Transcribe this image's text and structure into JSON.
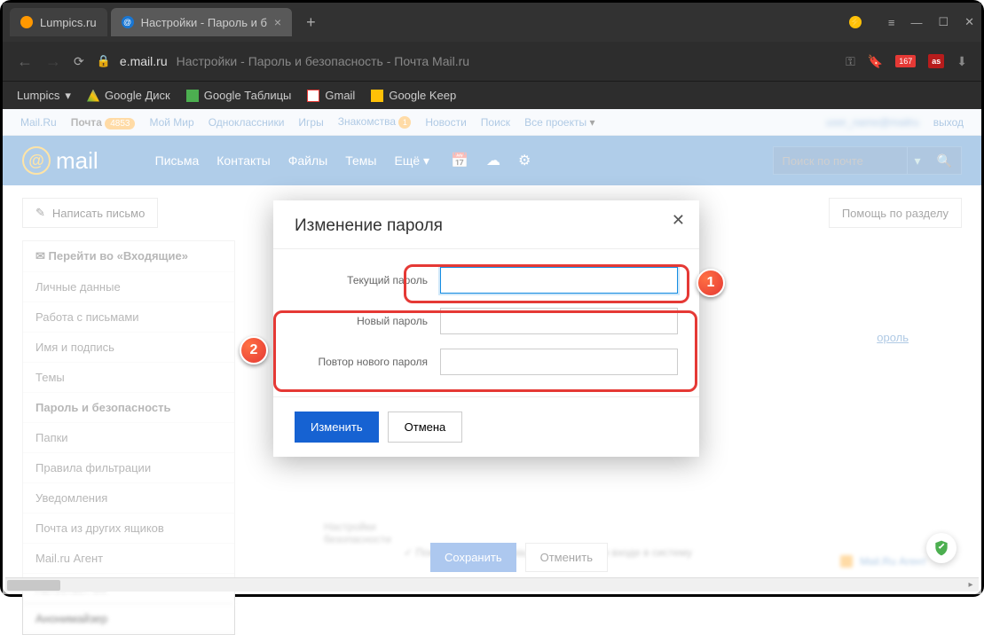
{
  "browser": {
    "tabs": [
      {
        "label": "Lumpics.ru",
        "favColor": "#ff9800"
      },
      {
        "label": "Настройки - Пароль и б",
        "favColor": "#1976d2"
      }
    ],
    "url_host": "e.mail.ru",
    "url_path": "Настройки - Пароль и безопасность - Почта Mail.ru",
    "badge": "167",
    "as": "as",
    "bookmarks": {
      "lumpics": "Lumpics",
      "gdrive": "Google Диск",
      "gsheets": "Google Таблицы",
      "gmail": "Gmail",
      "gkeep": "Google Keep"
    }
  },
  "topbar": {
    "mailru": "Mail.Ru",
    "pochta": "Почта",
    "pochta_count": "4853",
    "moymir": "Мой Мир",
    "odnokl": "Одноклассники",
    "igry": "Игры",
    "znak": "Знакомства",
    "znak_badge": "1",
    "novosti": "Новости",
    "poisk": "Поиск",
    "vse": "Все проекты",
    "user": "user_name@mailru",
    "exit": "выход"
  },
  "mailheader": {
    "logo": "mail",
    "pisma": "Письма",
    "kontakty": "Контакты",
    "faily": "Файлы",
    "temy": "Темы",
    "eshe": "Ещё",
    "search_placeholder": "Поиск по почте"
  },
  "toolbar": {
    "compose": "Написать письмо",
    "help": "Помощь по разделу"
  },
  "sidebar": {
    "inbox": "Перейти во «Входящие»",
    "items": [
      "Личные данные",
      "Работа с письмами",
      "Имя и подпись",
      "Темы",
      "Пароль и безопасность",
      "Папки",
      "Правила фильтрации",
      "Уведомления",
      "Почта из других ящиков",
      "Mail.ru Агент",
      "Автоответчик",
      "Анонимайзер"
    ]
  },
  "bg": {
    "link": "ороль",
    "sec1": "Настройки",
    "sec2": "безопасности",
    "check": "Показывать информацию о последнем входе в систему",
    "save": "Сохранить",
    "cancel": "Отменить",
    "agent": "Mail.Ru Агент"
  },
  "modal": {
    "title": "Изменение пароля",
    "current": "Текущий пароль",
    "new": "Новый пароль",
    "repeat": "Повтор нового пароля",
    "submit": "Изменить",
    "cancel": "Отмена"
  },
  "markers": {
    "one": "1",
    "two": "2"
  }
}
